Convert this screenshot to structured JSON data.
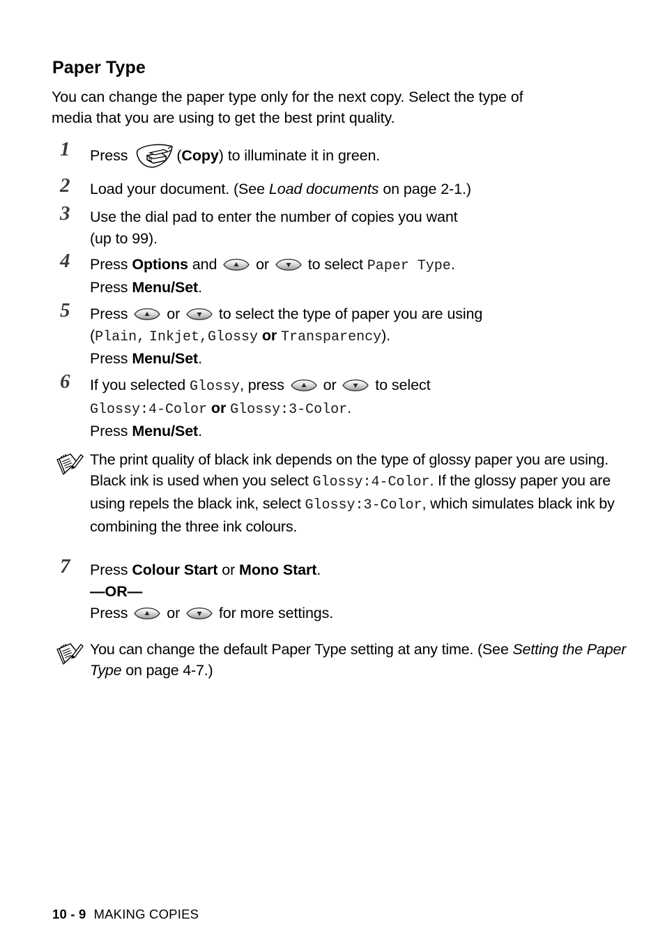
{
  "page": {
    "heading": "Paper Type",
    "intro": "You can change the paper type only for the next copy. Select the type of media that you are using to get the best print quality."
  },
  "steps": [
    {
      "num": "1",
      "parts": {
        "press": "Press",
        "copy_paren_open": "(",
        "copy_label": "Copy",
        "copy_paren_close": ")",
        "tail": "to illuminate it in green."
      }
    },
    {
      "num": "2",
      "parts": {
        "lead": "Load your document. (See",
        "ref_italic": "Load documents",
        "tail": "on page 2-1.)"
      }
    },
    {
      "num": "3",
      "parts": {
        "line1": "Use the dial pad to enter the number of copies you want",
        "line2": "(up to 99)."
      }
    },
    {
      "num": "4",
      "parts": {
        "press": "Press",
        "options": "Options",
        "and": "and",
        "or": "or",
        "to_select": "to select",
        "lcd": "Paper Type",
        "period": ".",
        "sub_press": "Press",
        "sub_bold": "Menu/Set",
        "sub_period": "."
      }
    },
    {
      "num": "5",
      "parts": {
        "press": "Press",
        "or": "or",
        "tail": "to select the type of paper you are using",
        "paren_open": "(",
        "opt1": "Plain,",
        "opt2": "Inkjet,",
        "opt3": "Glossy",
        "or_bold": "or",
        "opt4": "Transparency",
        "paren_close": ").",
        "sub_press": "Press",
        "sub_bold": "Menu/Set",
        "sub_period": "."
      }
    },
    {
      "num": "6",
      "parts": {
        "lead": "If you selected",
        "lcd_glossy": "Glossy",
        "comma_press": ", press",
        "or": "or",
        "to_select": "to select",
        "lcd_a": "Glossy:4-Color",
        "or_bold": "or",
        "lcd_b": "Glossy:3-Color",
        "period": ".",
        "sub_press": "Press",
        "sub_bold": "Menu/Set",
        "sub_period": "."
      }
    },
    {
      "num": "7",
      "parts": {
        "press": "Press",
        "colour_start": "Colour Start",
        "or": "or",
        "mono_start": "Mono Start",
        "period": ".",
        "or_divider": "—OR—",
        "sub_press": "Press",
        "sub_or": "or",
        "sub_tail": "for more settings."
      }
    }
  ],
  "notes": [
    {
      "segments": {
        "t1": "The print quality of black ink depends on the type of glossy paper you are using. Black ink is used when you select",
        "lcd1": "Glossy:4-Color",
        "t2": ". If the glossy paper you are using repels the black ink, select",
        "lcd2": "Glossy:3-Color",
        "t3": ", which simulates black ink by combining the three ink colours."
      }
    },
    {
      "segments": {
        "t1": "You can change the default Paper Type setting at any time. (See",
        "ref_italic": "Setting the Paper Type",
        "t2": "on page 4-7.)"
      }
    }
  ],
  "footer": {
    "page_number": "10 - 9",
    "section": "MAKING COPIES"
  },
  "icons": {
    "copy_key": "copy-key-icon",
    "arrow_up": "arrow-up-key-icon",
    "arrow_down": "arrow-down-key-icon",
    "note": "note-pencil-icon"
  },
  "colors": {
    "text": "#000000",
    "step_number": "#3b3b3b",
    "lcd_text": "#1a1a1a",
    "key_fill_light": "#f2f2f2",
    "key_fill_dark": "#a8a8a8"
  }
}
